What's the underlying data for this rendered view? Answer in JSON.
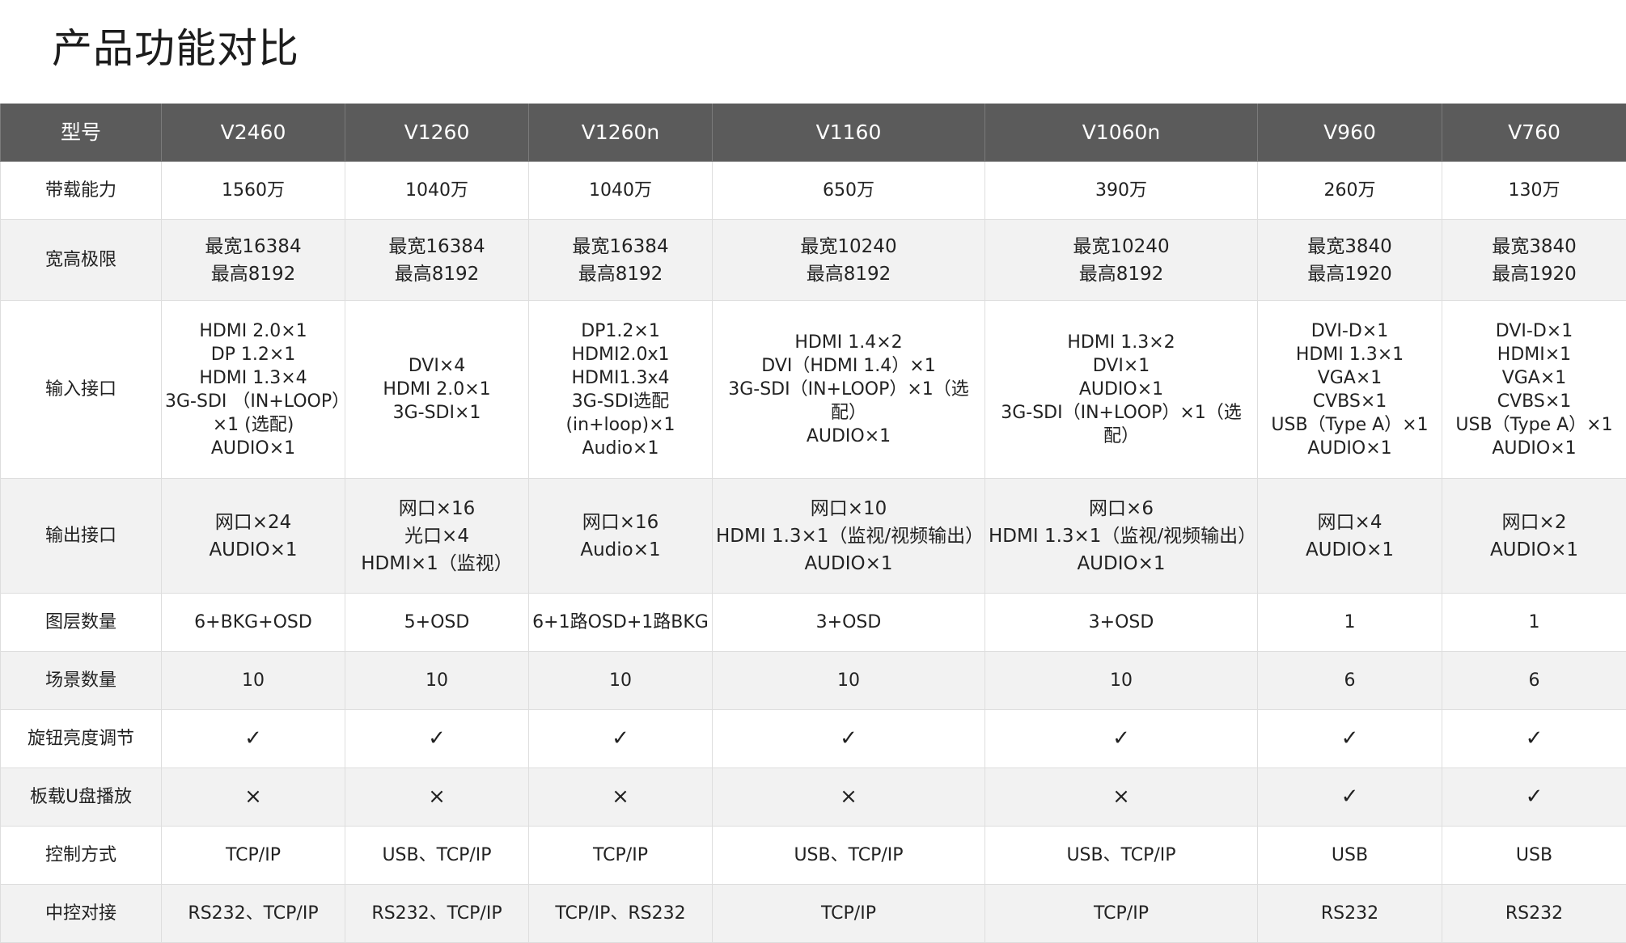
{
  "title": "产品功能对比",
  "header": {
    "label": "型号",
    "models": [
      "V2460",
      "V1260",
      "V1260n",
      "V1160",
      "V1060n",
      "V960",
      "V760"
    ]
  },
  "rows": [
    {
      "label": "带载能力",
      "cells": [
        [
          "1560万"
        ],
        [
          "1040万"
        ],
        [
          "1040万"
        ],
        [
          "650万"
        ],
        [
          "390万"
        ],
        [
          "260万"
        ],
        [
          "130万"
        ]
      ]
    },
    {
      "label": "宽高极限",
      "cells": [
        [
          "最宽16384",
          "最高8192"
        ],
        [
          "最宽16384",
          "最高8192"
        ],
        [
          "最宽16384",
          "最高8192"
        ],
        [
          "最宽10240",
          "最高8192"
        ],
        [
          "最宽10240",
          "最高8192"
        ],
        [
          "最宽3840",
          "最高1920"
        ],
        [
          "最宽3840",
          "最高1920"
        ]
      ]
    },
    {
      "label": "输入接口",
      "cells": [
        [
          "HDMI 2.0×1",
          "DP 1.2×1",
          "HDMI 1.3×4",
          "3G-SDI （IN+LOOP）",
          "×1 (选配)",
          "AUDIO×1"
        ],
        [
          "DVI×4",
          "HDMI 2.0×1",
          "3G-SDI×1"
        ],
        [
          "DP1.2×1",
          "HDMI2.0x1",
          "HDMI1.3x4",
          "3G-SDI选配",
          "(in+loop)×1",
          "Audio×1"
        ],
        [
          "HDMI 1.4×2",
          "DVI（HDMI 1.4）×1",
          "3G-SDI（IN+LOOP）×1（选配）",
          "AUDIO×1"
        ],
        [
          "HDMI 1.3×2",
          "DVI×1",
          "AUDIO×1",
          "3G-SDI（IN+LOOP）×1（选配）"
        ],
        [
          "DVI-D×1",
          "HDMI 1.3×1",
          "VGA×1",
          "CVBS×1",
          "USB（Type A）×1",
          "AUDIO×1"
        ],
        [
          "DVI-D×1",
          "HDMI×1",
          "VGA×1",
          "CVBS×1",
          "USB（Type A）×1",
          "AUDIO×1"
        ]
      ]
    },
    {
      "label": "输出接口",
      "cells": [
        [
          "网口×24",
          "AUDIO×1"
        ],
        [
          "网口×16",
          "光口×4",
          "HDMI×1（监视）"
        ],
        [
          "网口×16",
          "Audio×1"
        ],
        [
          "网口×10",
          "HDMI 1.3×1（监视/视频输出）",
          "AUDIO×1"
        ],
        [
          "网口×6",
          "HDMI 1.3×1（监视/视频输出）",
          "AUDIO×1"
        ],
        [
          "网口×4",
          "AUDIO×1"
        ],
        [
          "网口×2",
          "AUDIO×1"
        ]
      ]
    },
    {
      "label": "图层数量",
      "cells": [
        [
          "6+BKG+OSD"
        ],
        [
          "5+OSD"
        ],
        [
          "6+1路OSD+1路BKG"
        ],
        [
          "3+OSD"
        ],
        [
          "3+OSD"
        ],
        [
          "1"
        ],
        [
          "1"
        ]
      ]
    },
    {
      "label": "场景数量",
      "cells": [
        [
          "10"
        ],
        [
          "10"
        ],
        [
          "10"
        ],
        [
          "10"
        ],
        [
          "10"
        ],
        [
          "6"
        ],
        [
          "6"
        ]
      ]
    },
    {
      "label": "旋钮亮度调节",
      "cells": [
        [
          "✓"
        ],
        [
          "✓"
        ],
        [
          "✓"
        ],
        [
          "✓"
        ],
        [
          "✓"
        ],
        [
          "✓"
        ],
        [
          "✓"
        ]
      ]
    },
    {
      "label": "板载U盘播放",
      "cells": [
        [
          "×"
        ],
        [
          "×"
        ],
        [
          "×"
        ],
        [
          "×"
        ],
        [
          "×"
        ],
        [
          "✓"
        ],
        [
          "✓"
        ]
      ]
    },
    {
      "label": "控制方式",
      "cells": [
        [
          "TCP/IP"
        ],
        [
          "USB、TCP/IP"
        ],
        [
          "TCP/IP"
        ],
        [
          "USB、TCP/IP"
        ],
        [
          "USB、TCP/IP"
        ],
        [
          "USB"
        ],
        [
          "USB"
        ]
      ]
    },
    {
      "label": "中控对接",
      "cells": [
        [
          "RS232、TCP/IP"
        ],
        [
          "RS232、TCP/IP"
        ],
        [
          "TCP/IP、RS232"
        ],
        [
          "TCP/IP"
        ],
        [
          "TCP/IP"
        ],
        [
          "RS232"
        ],
        [
          "RS232"
        ]
      ]
    }
  ]
}
